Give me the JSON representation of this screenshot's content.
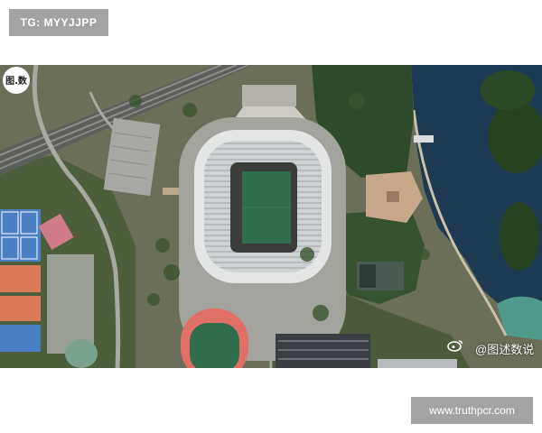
{
  "top_badge": {
    "text": "TG: MYYJJPP"
  },
  "corner_logo": {
    "text": "图.数"
  },
  "watermark": {
    "text": "@图述数说",
    "icon": "weibo-icon"
  },
  "bottom_badge": {
    "text": "www.truthpcr.com"
  },
  "colors": {
    "badge": "#a3a3a3",
    "water": "#1d3a52",
    "forest": "#2f4a2a",
    "track": "#e07066",
    "pitch": "#2f6d4c",
    "court_blue": "#4a7fc4",
    "court_orange": "#d77a55"
  }
}
